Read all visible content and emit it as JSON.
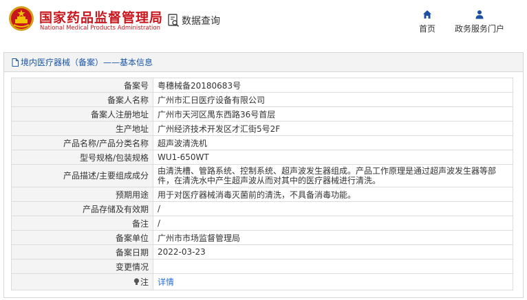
{
  "header": {
    "org_name_cn": "国家药品监督管理局",
    "org_name_en": "National Medical Products Administration",
    "query_label": "数据查询",
    "nav": [
      {
        "label": "首页",
        "icon": "home-icon"
      },
      {
        "label": "政务服务门户",
        "icon": "user-icon"
      }
    ]
  },
  "panel": {
    "title": "境内医疗器械（备案）——基本信息",
    "title_icon": "document-icon"
  },
  "record": [
    {
      "label": "备案号",
      "value": "粤穗械备20180683号"
    },
    {
      "label": "备案人名称",
      "value": "广州市汇日医疗设备有限公司"
    },
    {
      "label": "备案人注册地址",
      "value": "广州市天河区禺东西路36号首层"
    },
    {
      "label": "生产地址",
      "value": "广州经济技术开发区才汇街5号2F"
    },
    {
      "label": "产品名称/产品分类名称",
      "value": "超声波清洗机"
    },
    {
      "label": "型号规格/包装规格",
      "value": "WU1-650WT"
    },
    {
      "label": "产品描述/主要组成成分",
      "value": "由清洗槽、管路系统、控制系统、超声波发生器组成。产品工作原理是通过超声波发生器等部件，在清洗水中产生超声波从而对其中的医疗器械进行清洗。"
    },
    {
      "label": "预期用途",
      "value": "用于对医疗器械消毒灭菌前的清洗，不具备消毒功能。"
    },
    {
      "label": "产品存储及有效期",
      "value": "/"
    },
    {
      "label": "备注",
      "value": "/"
    },
    {
      "label": "备案单位",
      "value": "广州市市场监督管理局"
    },
    {
      "label": "备案日期",
      "value": "2022-03-23"
    },
    {
      "label": "变更情况",
      "value": ""
    },
    {
      "label": "注",
      "value": "详情",
      "label_icon": "lightbulb-icon"
    }
  ],
  "colors": {
    "brand_red": "#c8161d",
    "link_blue": "#2a6fd6",
    "title_blue": "#1a56a6",
    "label_bg": "#f4f4f4"
  }
}
